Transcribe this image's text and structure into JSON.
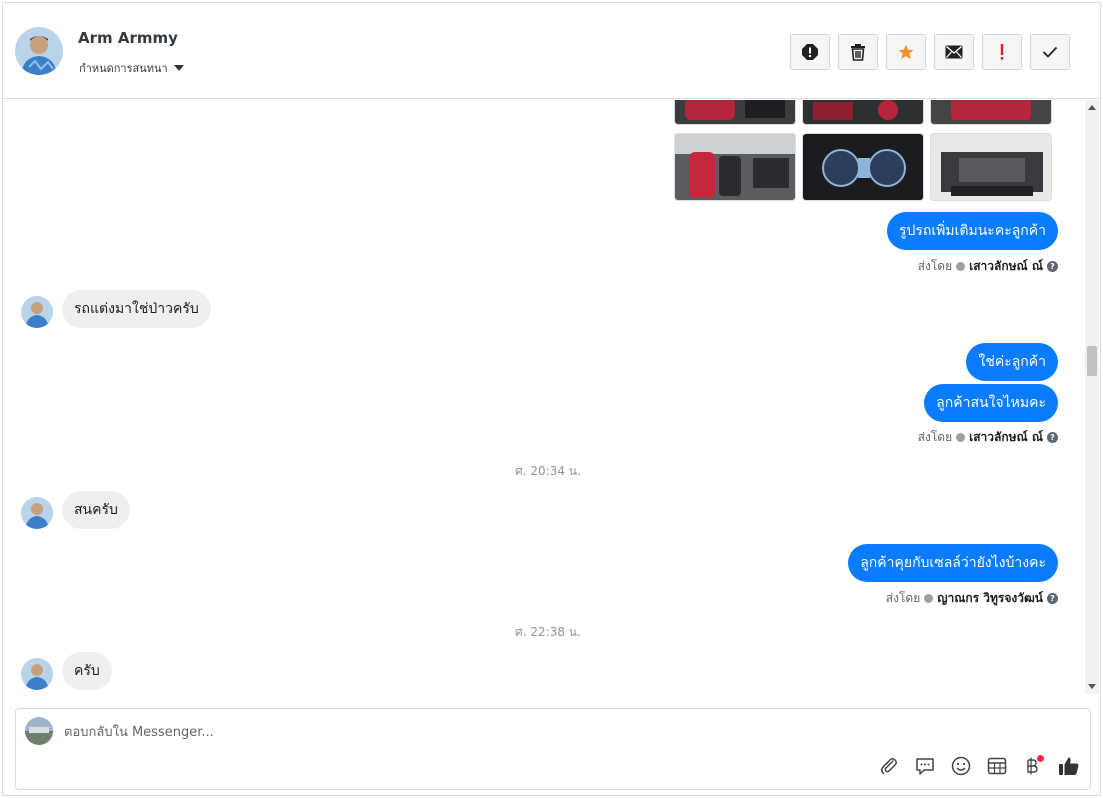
{
  "header": {
    "name": "Arm Armmy",
    "subtitle": "กำหนดการสนทนา",
    "actions": [
      {
        "name": "report-icon"
      },
      {
        "name": "trash-icon"
      },
      {
        "name": "star-icon",
        "color": "#f0952b"
      },
      {
        "name": "envelope-icon"
      },
      {
        "name": "exclamation-icon",
        "color": "#e02020"
      },
      {
        "name": "check-icon"
      }
    ]
  },
  "messages": {
    "m1": "รูปรถเพิ่มเติมนะคะลูกค้า",
    "m2": "รถแต่งมาใช่ป่าวครับ",
    "m3": "ใช่ค่ะลูกค้า",
    "m4": "ลูกค้าสนใจไหมคะ",
    "m5": "สนครับ",
    "m6": "ลูกค้าคุยกับเซลล์ว่ายังไงบ้างคะ",
    "m7": "ครับ"
  },
  "sent_by": {
    "prefix": "ส่งโดย",
    "agent1": "เสาวลักษณ์ ณ์",
    "agent2": "เสาวลักษณ์ ณ์",
    "agent3": "ญาณกร วิทูรจงวัฒน์"
  },
  "timestamps": {
    "t1": "ศ. 20:34 น.",
    "t2": "ศ. 22:38 น."
  },
  "composer": {
    "placeholder": "ตอบกลับใน Messenger...",
    "tools": [
      "paperclip-icon",
      "chat-bubble-icon",
      "smiley-icon",
      "table-icon",
      "baht-icon",
      "thumbs-up-icon"
    ]
  },
  "colors": {
    "outgoing_bubble": "#0a7cff",
    "incoming_bubble": "#eeeff1",
    "star": "#f0952b",
    "alert": "#e02020"
  }
}
